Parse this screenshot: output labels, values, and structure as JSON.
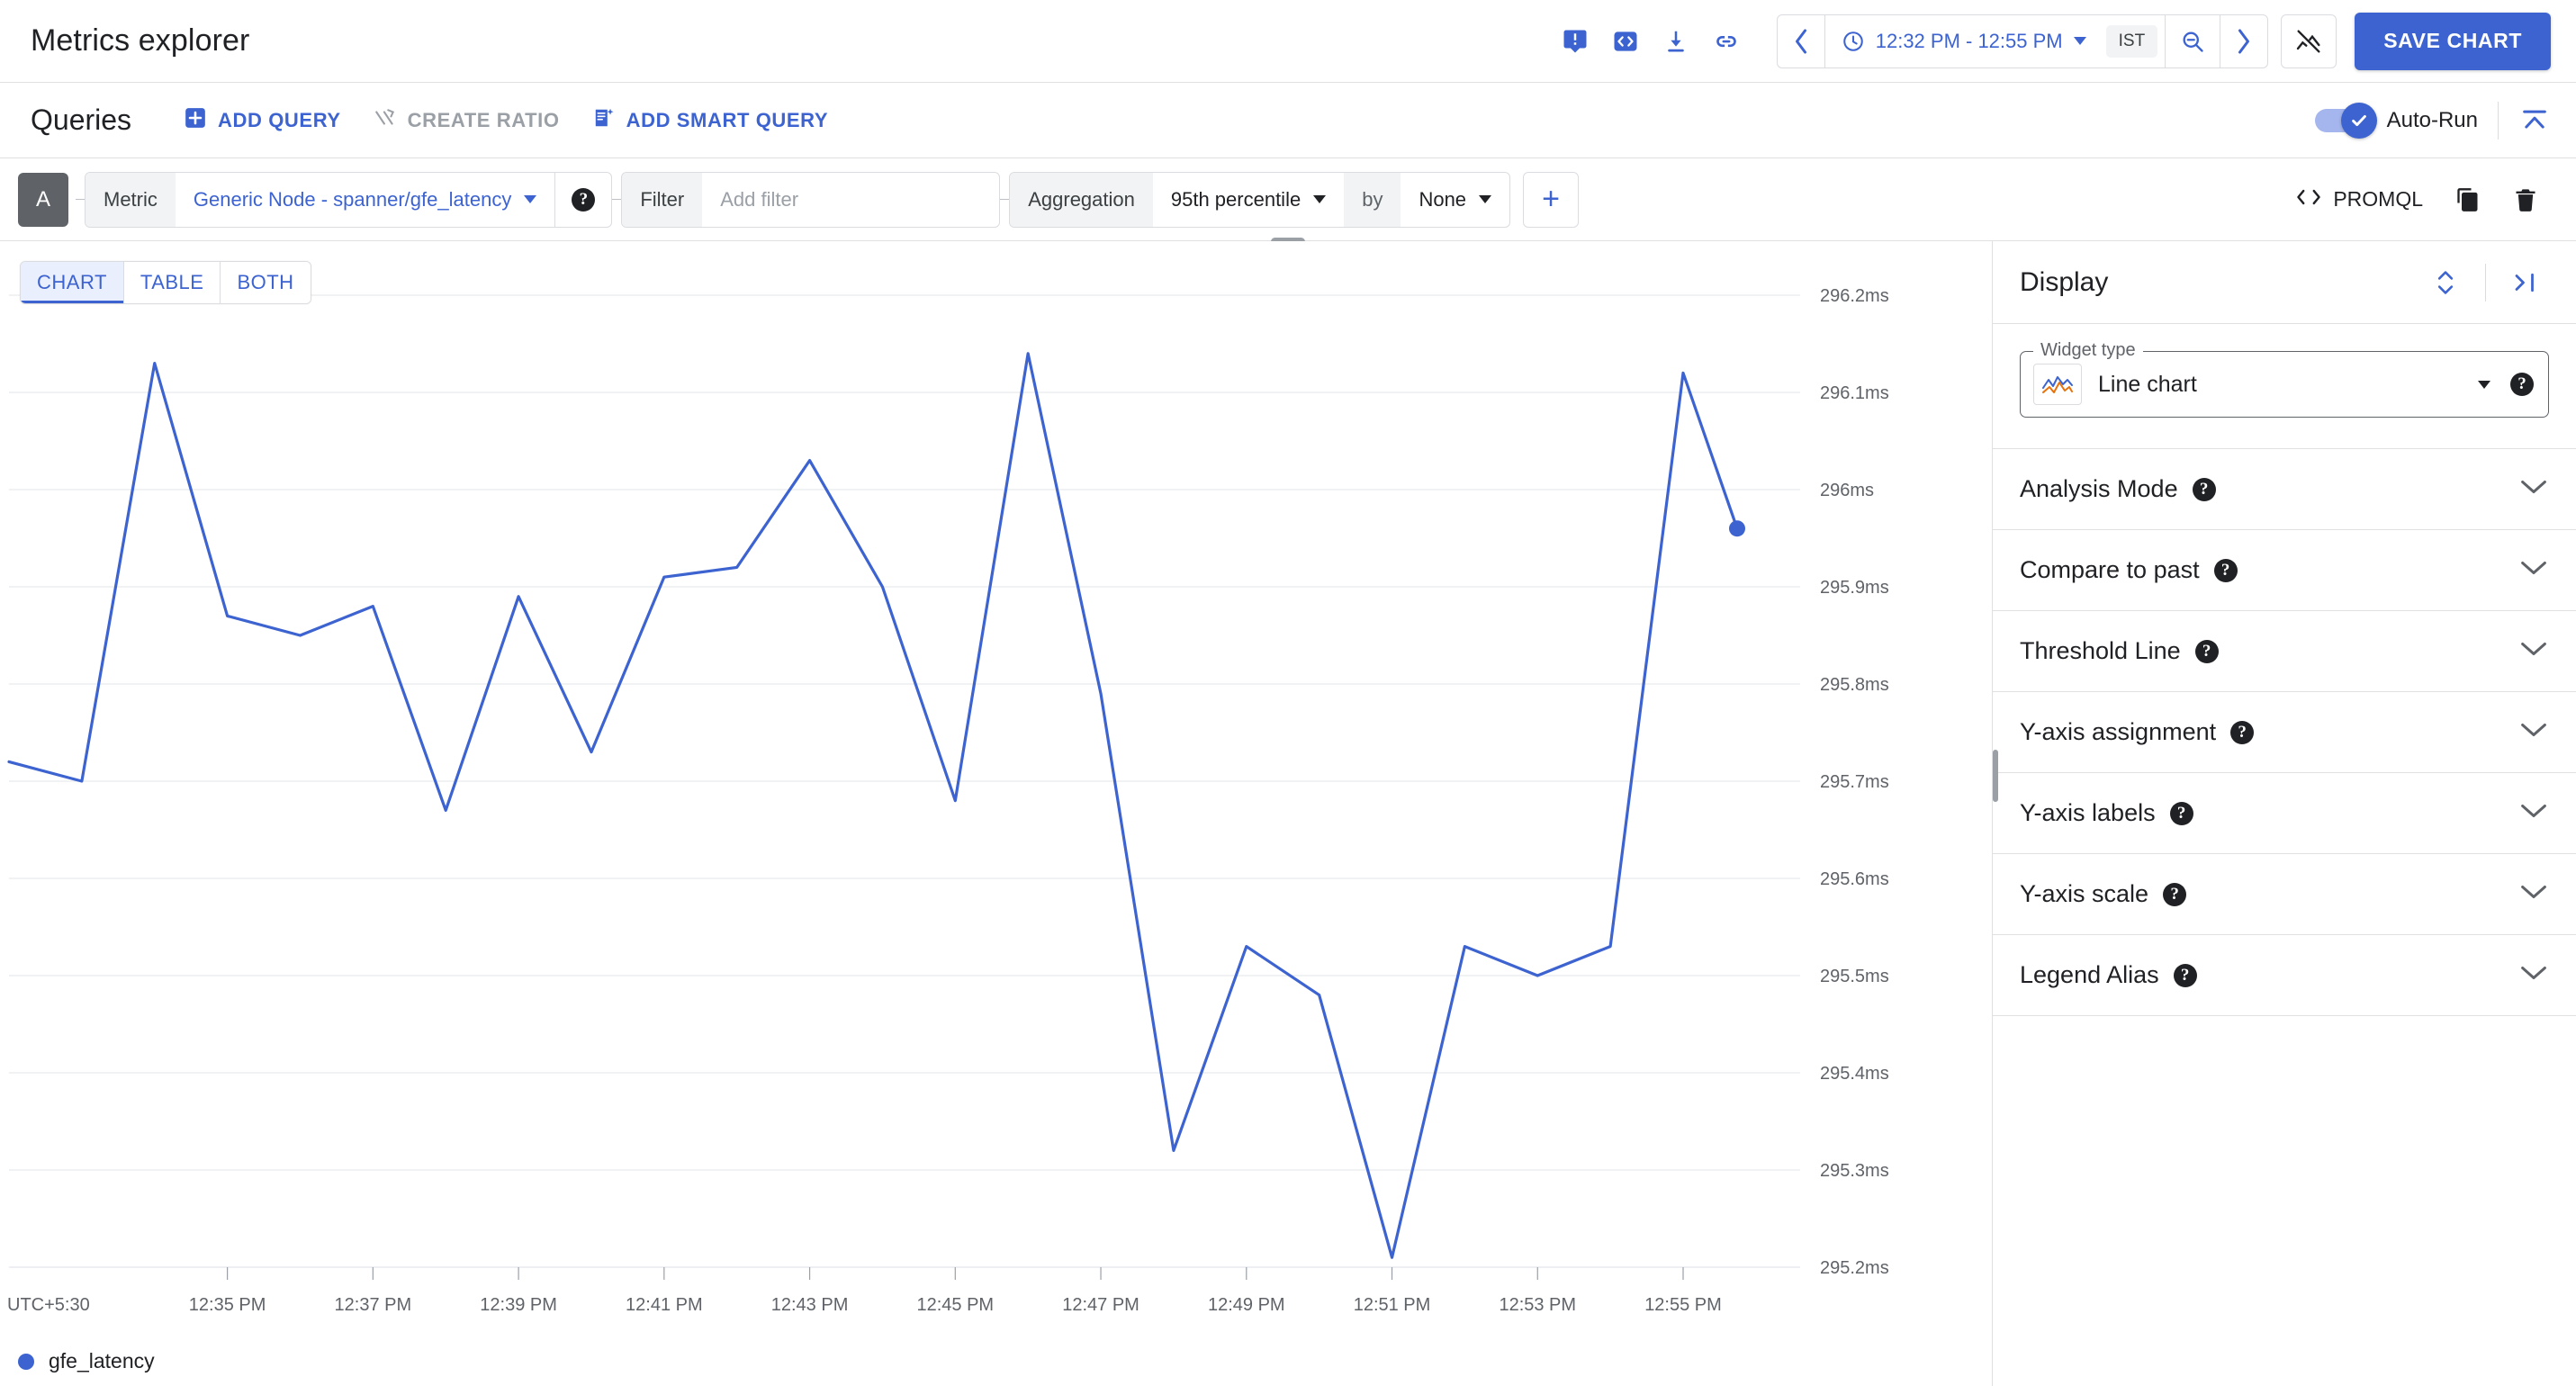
{
  "appbar": {
    "title": "Metrics explorer",
    "icons": [
      {
        "name": "feedback-icon",
        "label": "Send feedback"
      },
      {
        "name": "code-icon",
        "label": "View code"
      },
      {
        "name": "download-icon",
        "label": "Download"
      },
      {
        "name": "link-icon",
        "label": "Copy link"
      }
    ],
    "time_range": "12:32 PM - 12:55 PM",
    "timezone": "IST",
    "prev_label": "‹",
    "next_label": "›",
    "save_label": "SAVE CHART"
  },
  "queries": {
    "title": "Queries",
    "add_query_label": "ADD QUERY",
    "create_ratio_label": "CREATE RATIO",
    "add_smart_query_label": "ADD SMART QUERY",
    "autorun_label": "Auto-Run",
    "autorun_on": true
  },
  "query_row": {
    "letter": "A",
    "metric_label": "Metric",
    "metric_value": "Generic Node - spanner/gfe_latency",
    "filter_label": "Filter",
    "filter_placeholder": "Add filter",
    "filter_value": "",
    "aggregation_label": "Aggregation",
    "aggregation_value": "95th percentile",
    "by_label": "by",
    "groupby_value": "None",
    "add_label": "+",
    "promql_label": "PROMQL"
  },
  "view_tabs": [
    {
      "label": "CHART",
      "active": true
    },
    {
      "label": "TABLE",
      "active": false
    },
    {
      "label": "BOTH",
      "active": false
    }
  ],
  "display": {
    "title": "Display",
    "widget_type_legend": "Widget type",
    "widget_type_value": "Line chart",
    "sections": [
      {
        "label": "Analysis Mode"
      },
      {
        "label": "Compare to past"
      },
      {
        "label": "Threshold Line"
      },
      {
        "label": "Y-axis assignment"
      },
      {
        "label": "Y-axis labels"
      },
      {
        "label": "Y-axis scale"
      },
      {
        "label": "Legend Alias"
      }
    ]
  },
  "chart_data": {
    "type": "line",
    "title": "",
    "xlabel": "",
    "ylabel": "",
    "unit": "ms",
    "grid": true,
    "legend_position": "bottom-left",
    "accent_color": "#3c63d0",
    "timezone_label": "UTC+5:30",
    "ylim": [
      295.2,
      296.2
    ],
    "y_ticks": [
      296.2,
      296.1,
      296.0,
      295.9,
      295.8,
      295.7,
      295.6,
      295.5,
      295.4,
      295.3,
      295.2
    ],
    "y_tick_labels": [
      "296.2ms",
      "296.1ms",
      "296ms",
      "295.9ms",
      "295.8ms",
      "295.7ms",
      "295.6ms",
      "295.5ms",
      "295.4ms",
      "295.3ms",
      "295.2ms"
    ],
    "x_tick_labels": [
      "12:35 PM",
      "12:37 PM",
      "12:39 PM",
      "12:41 PM",
      "12:43 PM",
      "12:45 PM",
      "12:47 PM",
      "12:49 PM",
      "12:51 PM",
      "12:53 PM",
      "12:55 PM"
    ],
    "x_start": "12:32 PM",
    "x_end": "12:55 PM",
    "series": [
      {
        "name": "gfe_latency",
        "color": "#3c63d0",
        "end_marker": true,
        "x": [
          "12:32",
          "12:33",
          "12:34",
          "12:35",
          "12:36",
          "12:37",
          "12:38",
          "12:39",
          "12:40",
          "12:41",
          "12:42",
          "12:43",
          "12:44",
          "12:45",
          "12:46",
          "12:47",
          "12:48",
          "12:49",
          "12:50",
          "12:51",
          "12:52",
          "12:53",
          "12:54",
          "12:55"
        ],
        "values": [
          295.72,
          295.7,
          296.13,
          295.87,
          295.85,
          295.88,
          295.67,
          295.89,
          295.73,
          295.91,
          295.92,
          296.03,
          295.9,
          295.68,
          296.14,
          295.79,
          295.32,
          295.53,
          295.48,
          295.21,
          295.53,
          295.5,
          295.53,
          296.12
        ],
        "final_value": 295.96
      }
    ]
  }
}
